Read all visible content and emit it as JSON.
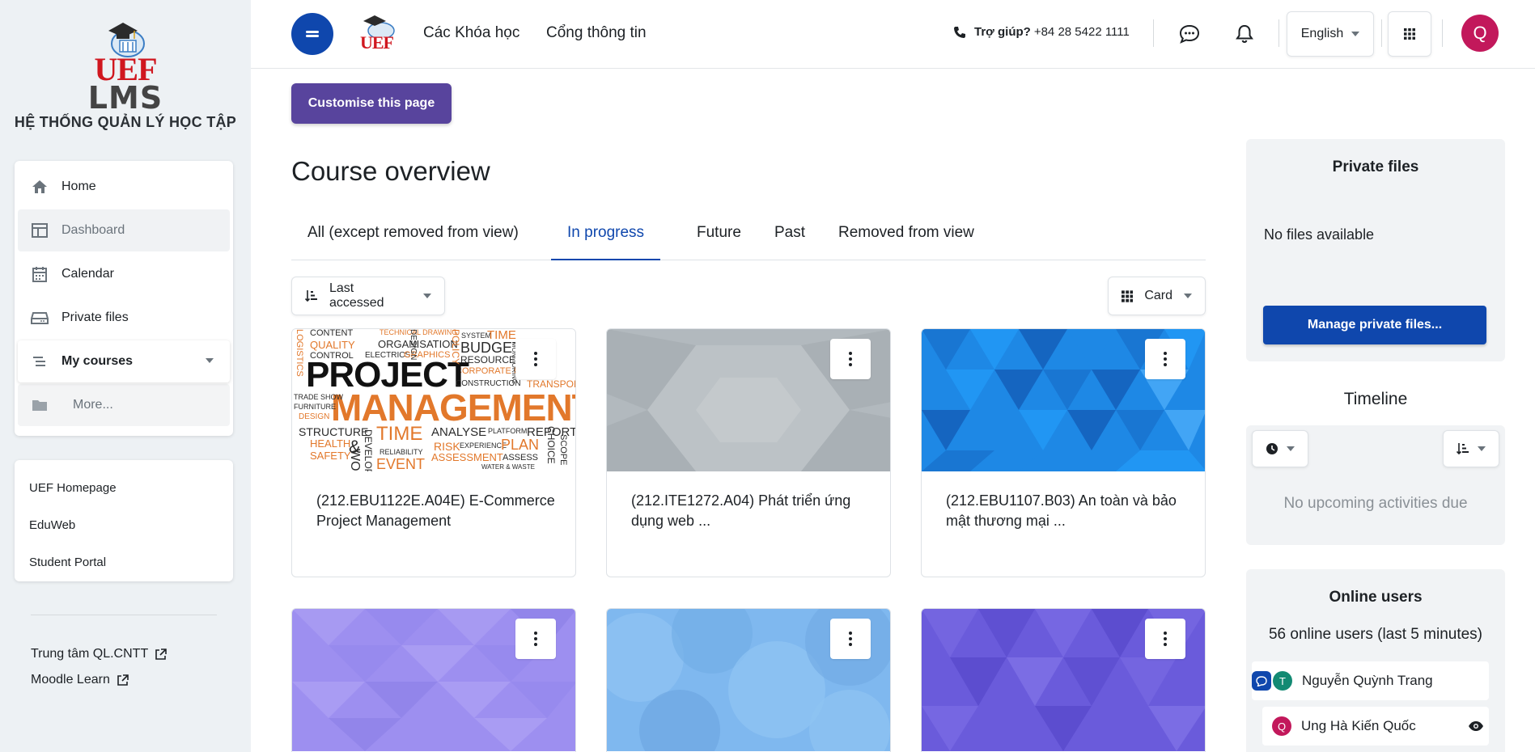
{
  "brand": {
    "logo_uef": "UEF",
    "logo_lms": "LMS",
    "logo_subtitle": "HỆ THỐNG QUẢN LÝ HỌC TẬP",
    "top_logo_text": "UEF"
  },
  "sidebar": {
    "items": [
      {
        "label": "Home",
        "icon": "home-icon"
      },
      {
        "label": "Dashboard",
        "icon": "dashboard-icon"
      },
      {
        "label": "Calendar",
        "icon": "calendar-icon"
      },
      {
        "label": "Private files",
        "icon": "drive-icon"
      },
      {
        "label": "My courses",
        "icon": "list-icon"
      },
      {
        "label": "More...",
        "icon": "folder-icon"
      }
    ],
    "links": [
      "UEF Homepage",
      "EduWeb",
      "Student Portal"
    ],
    "external": [
      "Trung tâm QL.CNTT",
      "Moodle Learn"
    ]
  },
  "topbar": {
    "nav": [
      "Các Khóa học",
      "Cổng thông tin"
    ],
    "help_label": "Trợ giúp?",
    "help_phone": "+84 28 5422 1111",
    "language": "English",
    "avatar_initial": "Q"
  },
  "main": {
    "customise_label": "Customise this page",
    "title": "Course overview",
    "tabs": [
      "All (except removed from view)",
      "In progress",
      "Future",
      "Past",
      "Removed from view"
    ],
    "active_tab": "In progress",
    "sort_label": "Last accessed",
    "view_label": "Card",
    "courses": [
      {
        "title": "(212.EBU1122E.A04E) E-Commerce Project Management"
      },
      {
        "title": "(212.ITE1272.A04) Phát triển ứng dụng web ..."
      },
      {
        "title": "(212.EBU1107.B03) An toàn và bảo mật thương mại ..."
      }
    ],
    "wordcloud": {
      "words": [
        "CONTENT",
        "QUALITY",
        "CONTROL",
        "TECHNICAL DRAWING",
        "ORGANISATION",
        "ELECTRICS",
        "GRAPHICS",
        "SYSTEM",
        "TIME",
        "BUDGET",
        "RESOURCES",
        "CORPORATE ID",
        "PROJECT",
        "MANAGEMENT",
        "CONSTRUCTION",
        "TRANSPORT",
        "TRADE SHOW",
        "FURNITURE",
        "DESIGN",
        "STRUCTURE",
        "TIME",
        "ANALYSE",
        "PLATFORM",
        "REPORT",
        "HEALTH",
        "&",
        "SAFETY",
        "WORK",
        "RELIABILITY",
        "EVENT",
        "RISK",
        "EXPERIENCE",
        "PLAN",
        "ASSESSMENT",
        "ASSESS",
        "WATER & WASTE",
        "MONITORING",
        "POLICY",
        "LOGISTICS",
        "DEVELOP",
        "CHOICE",
        "SCOPE",
        "DESIGN"
      ]
    }
  },
  "right": {
    "private_files": {
      "title": "Private files",
      "empty": "No files available",
      "button": "Manage private files..."
    },
    "timeline": {
      "title": "Timeline",
      "empty": "No upcoming activities due"
    },
    "online_users": {
      "title": "Online users",
      "count_text": "56 online users (last 5 minutes)",
      "users": [
        {
          "name": "Nguyễn Quỳnh Trang",
          "initial": "T",
          "color": "#138a73"
        },
        {
          "name": "Ung Hà Kiến Quốc",
          "initial": "Q",
          "color": "#c2185b"
        }
      ]
    }
  },
  "colors": {
    "primary": "#0f47ad",
    "customise": "#58449d",
    "accent_orange": "#e2782b"
  }
}
